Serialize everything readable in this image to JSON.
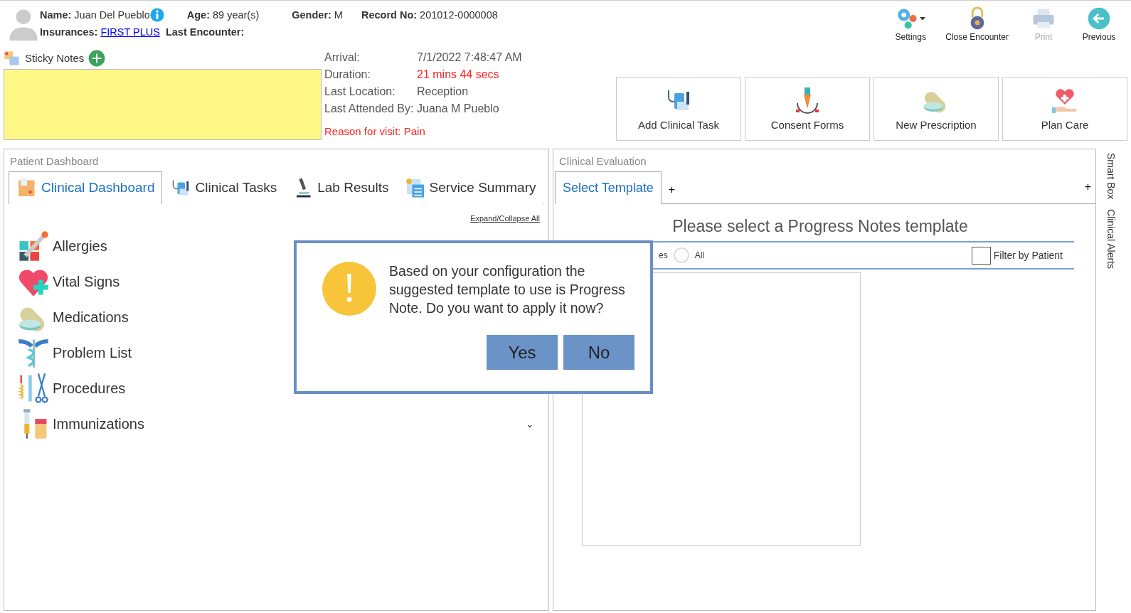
{
  "patient": {
    "name_label": "Name:",
    "name": "Juan Del Pueblo",
    "age_label": "Age:",
    "age": "89 year(s)",
    "gender_label": "Gender:",
    "gender": "M",
    "record_label": "Record No:",
    "record": "201012-0000008",
    "insurances_label": "Insurances:",
    "insurance": "FIRST PLUS",
    "last_encounter_label": "Last Encounter:"
  },
  "toolbar": [
    {
      "label": "Settings",
      "kind": "gears",
      "dropdown": true,
      "disabled": false
    },
    {
      "label": "Close Encounter",
      "kind": "lock",
      "dropdown": false,
      "disabled": false
    },
    {
      "label": "Print",
      "kind": "printer",
      "dropdown": false,
      "disabled": true
    },
    {
      "label": "Previous",
      "kind": "back",
      "dropdown": false,
      "disabled": false
    }
  ],
  "sticky_notes": {
    "label": "Sticky Notes"
  },
  "encounter": [
    {
      "label": "Arrival:",
      "value": "7/1/2022 7:48:47 AM",
      "alert": false
    },
    {
      "label": "Duration:",
      "value": "21 mins 44 secs",
      "alert": true
    },
    {
      "label": "Last Location:",
      "value": "Reception",
      "alert": false
    },
    {
      "label": "Last Attended By:",
      "value": "Juana M Pueblo",
      "alert": false
    }
  ],
  "reason": "Reason for visit: Pain",
  "actions": [
    {
      "label": "Add Clinical Task",
      "kind": "task"
    },
    {
      "label": "Consent Forms",
      "kind": "pen"
    },
    {
      "label": "New Prescription",
      "kind": "pill"
    },
    {
      "label": "Plan Care",
      "kind": "care"
    }
  ],
  "patient_dashboard": {
    "title": "Patient Dashboard",
    "tabs": [
      {
        "label": "Clinical Dashboard",
        "kind": "dashboard",
        "selected": true
      },
      {
        "label": "Clinical Tasks",
        "kind": "task",
        "selected": false
      },
      {
        "label": "Lab Results",
        "kind": "microscope",
        "selected": false
      },
      {
        "label": "Service Summary",
        "kind": "calculator",
        "selected": false
      }
    ],
    "expand_collapse": "Expand/Collapse All",
    "sections": [
      {
        "label": "Allergies",
        "kind": "allergy"
      },
      {
        "label": "Vital Signs",
        "kind": "heart"
      },
      {
        "label": "Medications",
        "kind": "pill"
      },
      {
        "label": "Problem List",
        "kind": "caduceus"
      },
      {
        "label": "Procedures",
        "kind": "tools"
      },
      {
        "label": "Immunizations",
        "kind": "vaccine",
        "chevron": "⌄"
      }
    ]
  },
  "clinical_evaluation": {
    "title": "Clinical Evaluation",
    "tabs": [
      {
        "label": "Select Template",
        "selected": true
      }
    ],
    "add_tab": "+",
    "add_right": "+",
    "heading": "Please select a Progress Notes template",
    "partial_option": "es",
    "radio": {
      "label": "All",
      "selected": false
    },
    "filter": {
      "label": "Filter by Patient",
      "checked": false
    }
  },
  "side_tabs": [
    "Smart Box",
    "Clinical Alerts"
  ],
  "dialog": {
    "message": "Based on your configuration the suggested template to use is Progress Note. Do you want to apply it now?",
    "buttons": [
      "Yes",
      "No"
    ]
  }
}
